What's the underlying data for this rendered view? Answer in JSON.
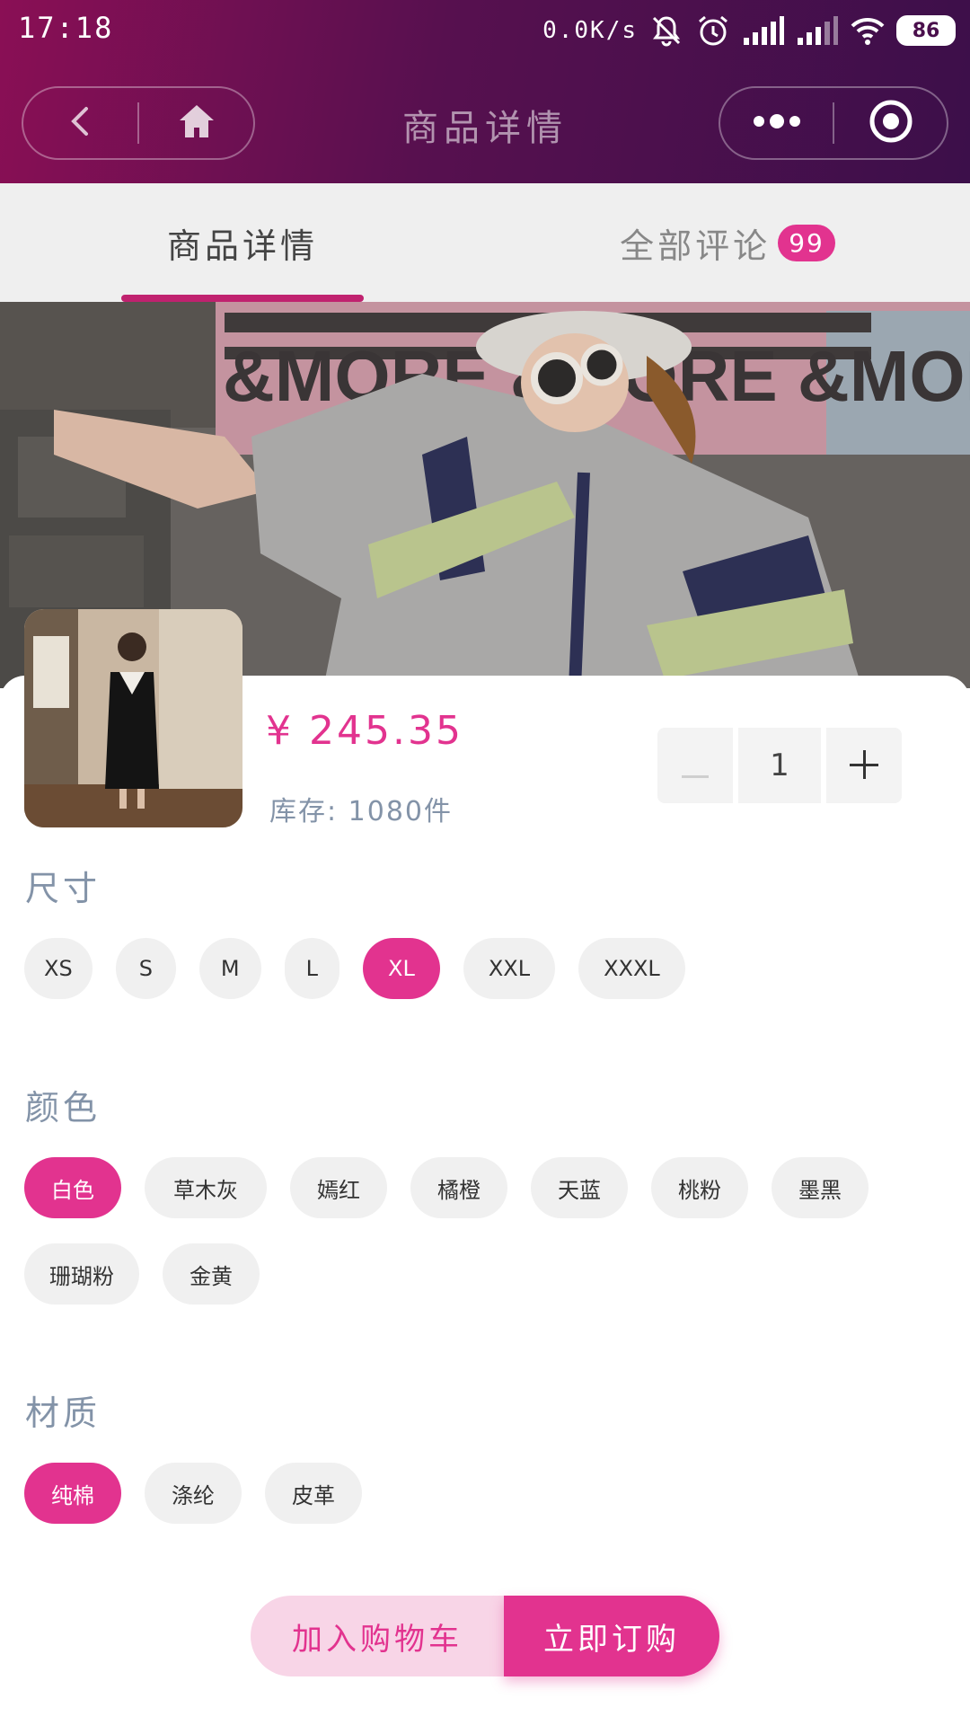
{
  "status_bar": {
    "time": "17:18",
    "net_speed": "0.0K/s",
    "battery": "86"
  },
  "nav": {
    "title": "商品详情"
  },
  "tabs": [
    {
      "label": "商品详情",
      "active": true
    },
    {
      "label": "全部评论",
      "badge": "99",
      "active": false
    }
  ],
  "product": {
    "price": "¥ 245.35",
    "stock": "库存: 1080件",
    "quantity": "1"
  },
  "size": {
    "title": "尺寸",
    "options": [
      "XS",
      "S",
      "M",
      "L",
      "XL",
      "XXL",
      "XXXL"
    ],
    "selected": "XL"
  },
  "color": {
    "title": "颜色",
    "options": [
      "白色",
      "草木灰",
      "嫣红",
      "橘橙",
      "天蓝",
      "桃粉",
      "墨黑",
      "珊瑚粉",
      "金黄"
    ],
    "selected": "白色"
  },
  "material": {
    "title": "材质",
    "options": [
      "纯棉",
      "涤纶",
      "皮革"
    ],
    "selected": "纯棉"
  },
  "hero_banner_text": "&MORE &MORE &MORE &MORE",
  "actions": {
    "add_to_cart": "加入购物车",
    "buy_now": "立即订购"
  },
  "colors": {
    "accent": "#e2338f",
    "header_start": "#8a0f55",
    "header_end": "#3c0f4a",
    "muted_text": "#8393a8",
    "chip_bg": "#f0f0f0"
  },
  "icons": [
    "back-icon",
    "home-icon",
    "more-icon",
    "target-icon",
    "mute-icon",
    "alarm-icon",
    "signal-icon",
    "wifi-icon"
  ]
}
